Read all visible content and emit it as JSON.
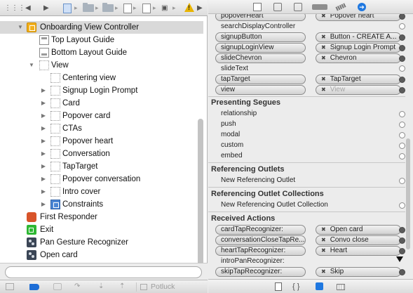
{
  "jump_bar": {
    "nav_back": "◀",
    "nav_forward": "▶",
    "sep": "▸",
    "warning_mark": "!"
  },
  "outline": {
    "items": [
      {
        "label": "Onboarding View Controller",
        "icon": "view-controller-icon",
        "disclosure": "▼",
        "selected": true
      },
      {
        "label": "Top Layout Guide",
        "icon": "top-layout-guide-icon"
      },
      {
        "label": "Bottom Layout Guide",
        "icon": "bottom-layout-guide-icon"
      },
      {
        "label": "View",
        "icon": "view-icon",
        "disclosure": "▼"
      },
      {
        "label": "Centering view",
        "icon": "view-icon"
      },
      {
        "label": "Signup Login Prompt",
        "icon": "view-icon",
        "disclosure": "▶"
      },
      {
        "label": "Card",
        "icon": "view-icon",
        "disclosure": "▶"
      },
      {
        "label": "Popover card",
        "icon": "view-icon",
        "disclosure": "▶"
      },
      {
        "label": "CTAs",
        "icon": "view-icon",
        "disclosure": "▶"
      },
      {
        "label": "Popover heart",
        "icon": "view-icon",
        "disclosure": "▶"
      },
      {
        "label": "Conversation",
        "icon": "view-icon",
        "disclosure": "▶"
      },
      {
        "label": "TapTarget",
        "icon": "view-icon",
        "disclosure": "▶"
      },
      {
        "label": "Popover conversation",
        "icon": "view-icon",
        "disclosure": "▶"
      },
      {
        "label": "Intro cover",
        "icon": "view-icon",
        "disclosure": "▶"
      },
      {
        "label": "Constraints",
        "icon": "constraints-icon",
        "disclosure": "▶"
      },
      {
        "label": "First Responder",
        "icon": "first-responder-icon"
      },
      {
        "label": "Exit",
        "icon": "exit-icon"
      },
      {
        "label": "Pan Gesture Recognizer",
        "icon": "pan-gesture-icon"
      },
      {
        "label": "Open card",
        "icon": "open-card-icon"
      }
    ],
    "filter_placeholder": ""
  },
  "bottom_bar": {
    "potluck_label": "Potluck"
  },
  "connections": {
    "outlets": [
      {
        "name": "popoverHeart",
        "target": "Popover heart",
        "connected": true
      },
      {
        "name": "searchDisplayController",
        "target": "",
        "connected": false
      },
      {
        "name": "signupButton",
        "target": "Button - CREATE A...",
        "connected": true
      },
      {
        "name": "signupLoginView",
        "target": "Signup Login Prompt",
        "connected": true
      },
      {
        "name": "slideChevron",
        "target": "Chevron",
        "connected": true
      },
      {
        "name": "slideText",
        "target": "",
        "connected": false
      },
      {
        "name": "tapTarget",
        "target": "TapTarget",
        "connected": true
      },
      {
        "name": "view",
        "target": "View",
        "connected": true,
        "dim_target": true
      }
    ],
    "segues_title": "Presenting Segues",
    "segues": [
      "relationship",
      "push",
      "modal",
      "custom",
      "embed"
    ],
    "ref_outlets_title": "Referencing Outlets",
    "new_ref_outlet": "New Referencing Outlet",
    "ref_collections_title": "Referencing Outlet Collections",
    "new_ref_collection": "New Referencing Outlet Collection",
    "actions_title": "Received Actions",
    "actions": [
      {
        "name": "cardTapRecognizer:",
        "target": "Open card",
        "connected": true
      },
      {
        "name": "conversationCloseTapRe...",
        "target": "Convo close",
        "connected": true
      },
      {
        "name": "heartTapRecognizer:",
        "target": "Heart",
        "connected": true
      },
      {
        "name": "introPanRecognizer:",
        "target": "",
        "connected": false
      },
      {
        "name": "skipTapRecognizer:",
        "target": "Skip",
        "connected": true
      }
    ]
  },
  "inspector_tabs": {
    "braces_label": "{ }"
  },
  "colors": {
    "accent_blue": "#1f78e0",
    "warning_yellow": "#e8b400",
    "selection_gray": "#d9d9d9"
  }
}
